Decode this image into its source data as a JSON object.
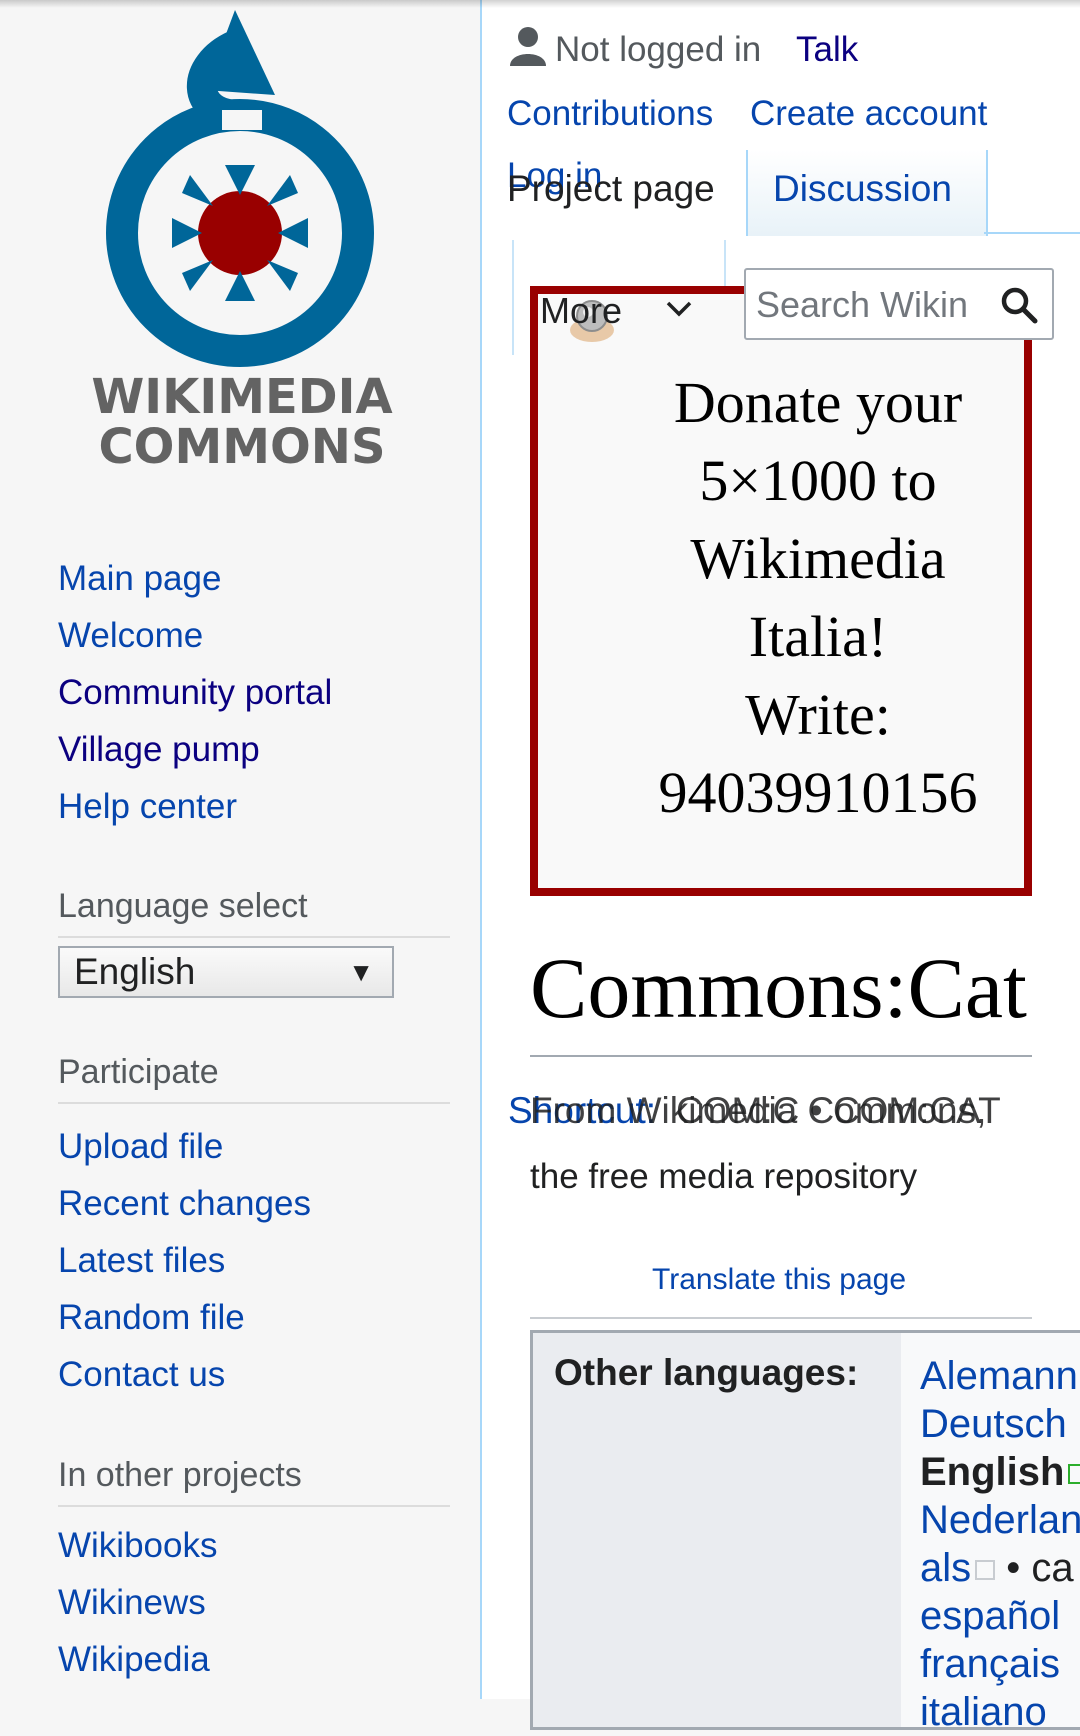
{
  "logo": {
    "line1": "WIKIMEDIA",
    "line2": "COMMONS"
  },
  "sidebar": {
    "nav": [
      {
        "label": "Main page",
        "visited": false
      },
      {
        "label": "Welcome",
        "visited": false
      },
      {
        "label": "Community portal",
        "visited": true
      },
      {
        "label": "Village pump",
        "visited": true
      },
      {
        "label": "Help center",
        "visited": false
      }
    ],
    "language_select_heading": "Language select",
    "language_selected": "English",
    "participate_heading": "Participate",
    "participate": [
      "Upload file",
      "Recent changes",
      "Latest files",
      "Random file",
      "Contact us"
    ],
    "other_projects_heading": "In other projects",
    "other_projects": [
      "Wikibooks",
      "Wikinews",
      "Wikipedia"
    ]
  },
  "personal": {
    "not_logged_in": "Not logged in",
    "talk": "Talk",
    "contributions": "Contributions",
    "create_account": "Create account",
    "log_in": "Log in"
  },
  "tabs": {
    "project_page": "Project page",
    "discussion": "Discussion",
    "more": "More"
  },
  "search": {
    "placeholder": "Search Wikin"
  },
  "banner": {
    "lines": [
      "Donate your",
      "5×1000 to",
      "Wikimedia",
      "Italia!",
      "Write:",
      "94039910156"
    ]
  },
  "page": {
    "title": "Commons:Cat",
    "shortcut_label": "Shortcut:",
    "shortcut_codes": "COM:C • COM:CAT",
    "from_line1": "From Wikimedia Commons,",
    "from_line2": "the free media repository",
    "translate": "Translate this page"
  },
  "other_languages": {
    "label": "Other languages:",
    "items": [
      {
        "text": "Alemann",
        "bold": false
      },
      {
        "text": "Deutsch",
        "bold": false
      },
      {
        "text": "English",
        "bold": true
      },
      {
        "text": "Nederlan",
        "bold": false
      },
      {
        "text": "als",
        "bold": false,
        "suffix": "• ca"
      },
      {
        "text": "español",
        "bold": false
      },
      {
        "text": "français",
        "bold": false
      },
      {
        "text": "italiano",
        "bold": false
      }
    ]
  },
  "colors": {
    "link": "#0645ad",
    "visited_link": "#0b0080",
    "banner_border": "#990000",
    "logo_blue": "#069",
    "logo_red": "#900"
  }
}
